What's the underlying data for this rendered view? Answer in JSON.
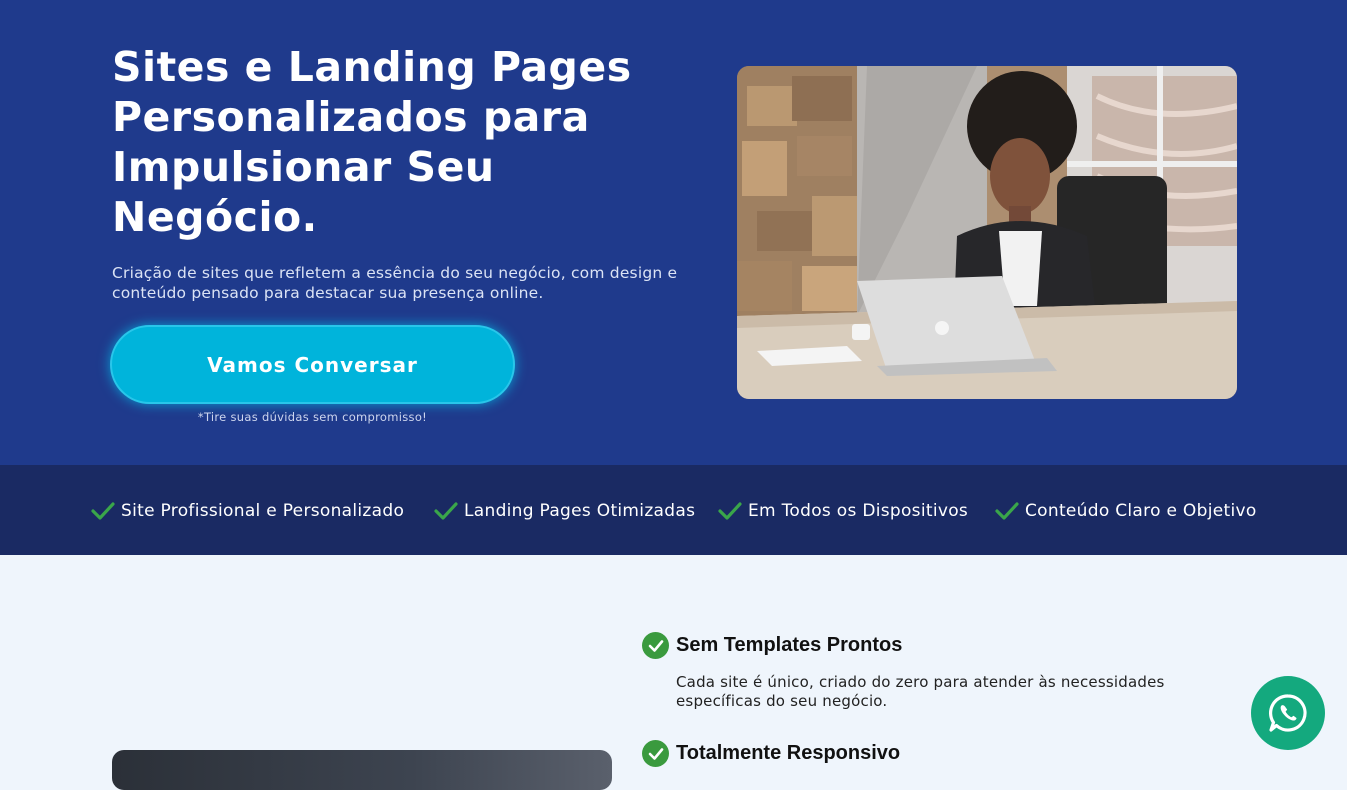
{
  "hero": {
    "title": "Sites e Landing Pages Personalizados para Impulsionar Seu Negócio.",
    "subtitle": "Criação de sites que refletem a essência do seu negócio, com design e conteúdo pensado para destacar sua presença online.",
    "cta_label": "Vamos Conversar",
    "cta_note": "*Tire suas dúvidas sem compromisso!",
    "photo_icon": "woman-at-laptop-photo"
  },
  "features": [
    {
      "label": "Site Profissional e Personalizado"
    },
    {
      "label": "Landing Pages Otimizadas"
    },
    {
      "label": "Em Todos os Dispositivos"
    },
    {
      "label": "Conteúdo Claro e Objetivo"
    }
  ],
  "benefits": [
    {
      "title": "Sem Templates Prontos",
      "description": "Cada site é único, criado do zero para atender às necessidades específicas do seu negócio."
    },
    {
      "title": "Totalmente Responsivo",
      "description": ""
    }
  ],
  "whatsapp": {
    "icon": "whatsapp-icon"
  },
  "colors": {
    "hero_bg": "#1f3a8c",
    "features_bg": "#1a2a63",
    "accent": "#00b4db",
    "check": "#3a9a3e",
    "whatsapp": "#14a97e",
    "page_bg": "#eff5fc"
  }
}
